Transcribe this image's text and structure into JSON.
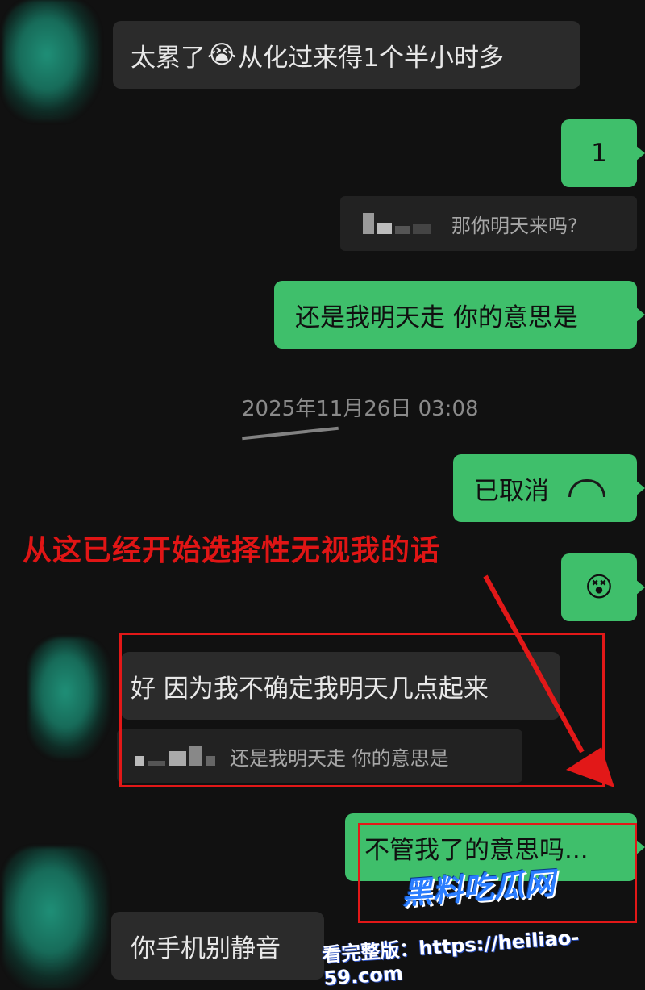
{
  "messages": {
    "m1": "太累了",
    "m1_emoji": "😭",
    "m1_tail": "从化过来得1个半小时多",
    "m2": "1",
    "m3_quote": "那你明天来吗?",
    "m4": "还是我明天走 你的意思是",
    "call_label": "已取消",
    "call_icon": "☎",
    "emoji_message": "😵",
    "m5": "好 因为我不确定我明天几点起来",
    "m5_quote": "还是我明天走 你的意思是",
    "m6": "不管我了的意思吗...",
    "m7": "你手机别静音"
  },
  "timestamp": "2025年11月26日 03:08",
  "annotation": "从这已经开始选择性无视我的话",
  "watermark": {
    "logo": "黑料吃瓜网",
    "prefix": "看完整版：https://heiliao-59.com",
    "url": "heiliao-59.com"
  },
  "colors": {
    "background": "#111111",
    "outgoing_bubble": "#3fbf6b",
    "incoming_bubble": "#2b2b2b",
    "annotation_red": "#e01515"
  }
}
